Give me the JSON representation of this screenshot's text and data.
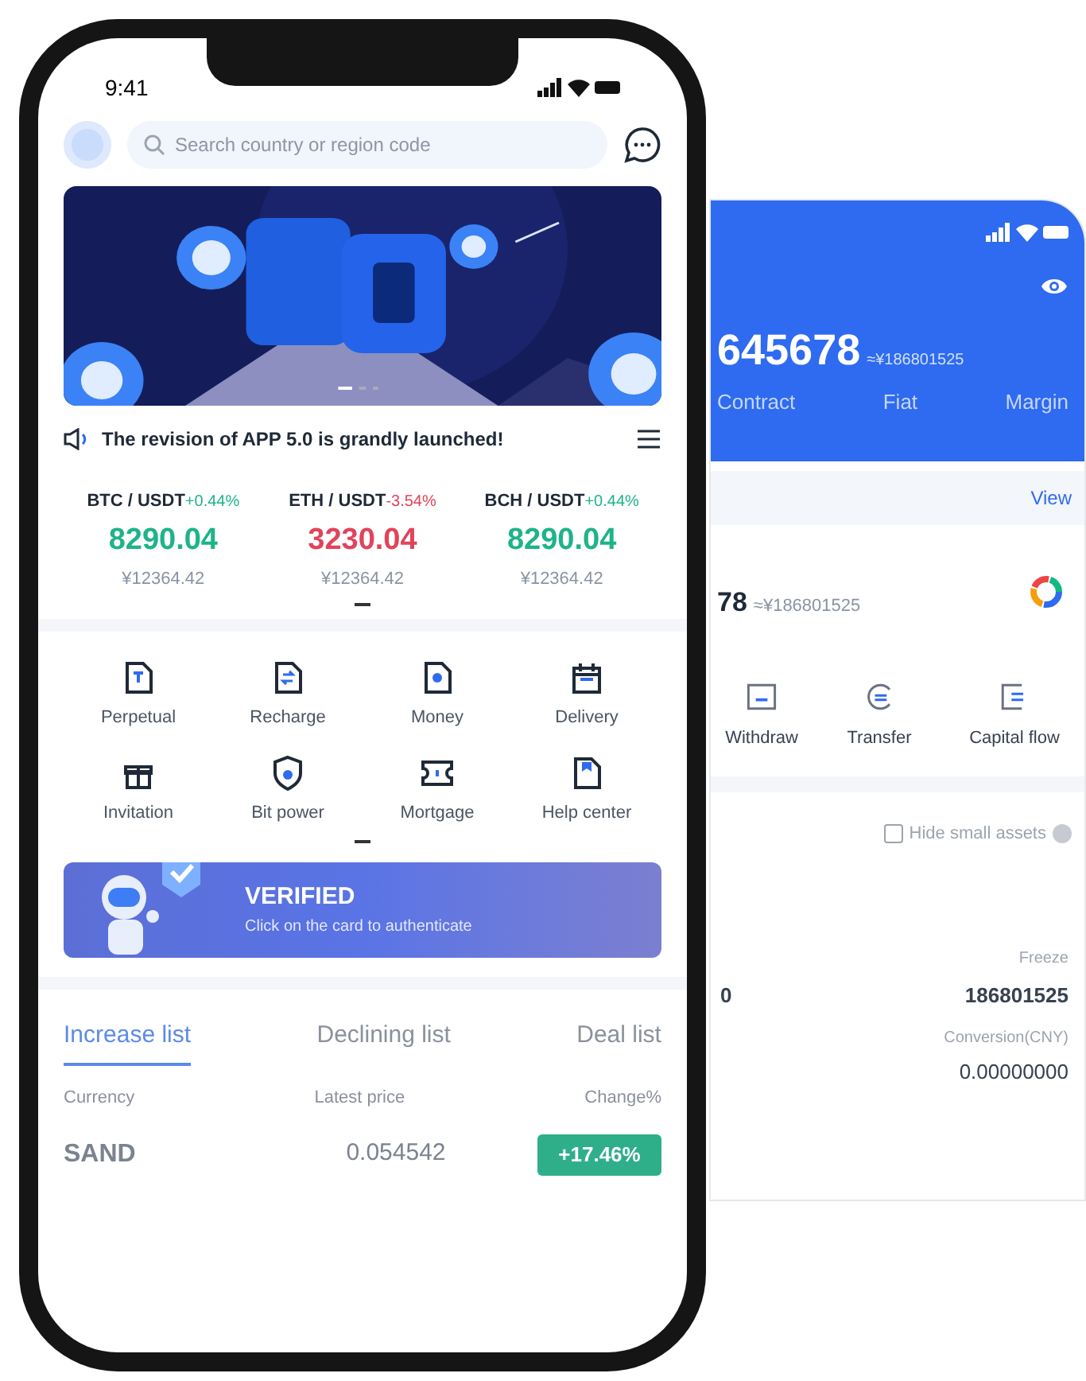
{
  "front_phone": {
    "status_bar": {
      "time": "9:41"
    },
    "search": {
      "placeholder": "Search country or region code"
    },
    "announcement": "The revision of APP 5.0 is grandly launched!",
    "tickers": [
      {
        "pair": "BTC / USDT",
        "change": "+0.44%",
        "color": "#1fb38a",
        "price": "8290.04",
        "cny": "¥12364.42"
      },
      {
        "pair": "ETH / USDT",
        "change": "-3.54%",
        "color": "#e0445b",
        "price": "3230.04",
        "cny": "¥12364.42"
      },
      {
        "pair": "BCH / USDT",
        "change": "+0.44%",
        "color": "#1fb38a",
        "price": "8290.04",
        "cny": "¥12364.42"
      }
    ],
    "shortcuts": [
      {
        "label": "Perpetual",
        "kind": "contract"
      },
      {
        "label": "Recharge",
        "kind": "exchange"
      },
      {
        "label": "Money",
        "kind": "coin"
      },
      {
        "label": "Delivery",
        "kind": "calendar"
      },
      {
        "label": "Invitation",
        "kind": "gift"
      },
      {
        "label": "Bit power",
        "kind": "shield"
      },
      {
        "label": "Mortgage",
        "kind": "ticket"
      },
      {
        "label": "Help center",
        "kind": "bookmark"
      }
    ],
    "verify_card": {
      "title": "VERIFIED",
      "subtitle": "Click on the card to authenticate"
    },
    "list_tabs": [
      {
        "label": "Increase list",
        "selected": true
      },
      {
        "label": "Declining list",
        "selected": false
      },
      {
        "label": "Deal list",
        "selected": false
      }
    ],
    "table": {
      "columns": [
        "Currency",
        "Latest price",
        "Change%"
      ],
      "rows": [
        {
          "currency": "SAND",
          "price": "0.054542",
          "change": "+17.46%"
        }
      ]
    }
  },
  "back_phone": {
    "header": {
      "balance": "645678",
      "balance_cny": "≈¥186801525",
      "tabs": [
        {
          "label": "Contract"
        },
        {
          "label": "Fiat"
        },
        {
          "label": "Margin"
        }
      ]
    },
    "view_link": "View",
    "summary": {
      "amount": "78",
      "amount_cny": "≈¥186801525"
    },
    "actions": [
      {
        "label": "Withdraw",
        "kind": "withdraw"
      },
      {
        "label": "Transfer",
        "kind": "transfer"
      },
      {
        "label": "Capital flow",
        "kind": "flow"
      }
    ],
    "hide_small": {
      "label": "Hide small assets",
      "checked": false
    },
    "asset": {
      "amount": "0",
      "freeze_label": "Freeze",
      "freeze": "186801525",
      "conversion_label": "Conversion(CNY)",
      "conversion": "0.00000000"
    }
  }
}
